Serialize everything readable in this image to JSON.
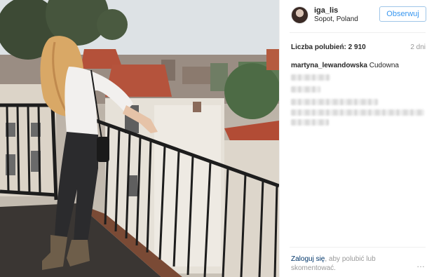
{
  "post": {
    "username": "iga_lis",
    "location": "Sopot, Poland",
    "follow_label": "Obserwuj",
    "likes_label": "Liczba polubień:",
    "likes_count": "2 910",
    "time_ago": "2 dni",
    "comments": [
      {
        "user": "martyna_lewandowska",
        "text": "Cudowna"
      }
    ],
    "login_prompt": {
      "link": "Zaloguj się",
      "text": ", aby polubić lub skomentować."
    },
    "more_label": "…"
  },
  "icons": {
    "more": "more-options-icon",
    "avatar": "profile-avatar"
  },
  "colors": {
    "accent": "#3897f0",
    "username": "#262626",
    "muted": "#999999",
    "link": "#003569"
  }
}
